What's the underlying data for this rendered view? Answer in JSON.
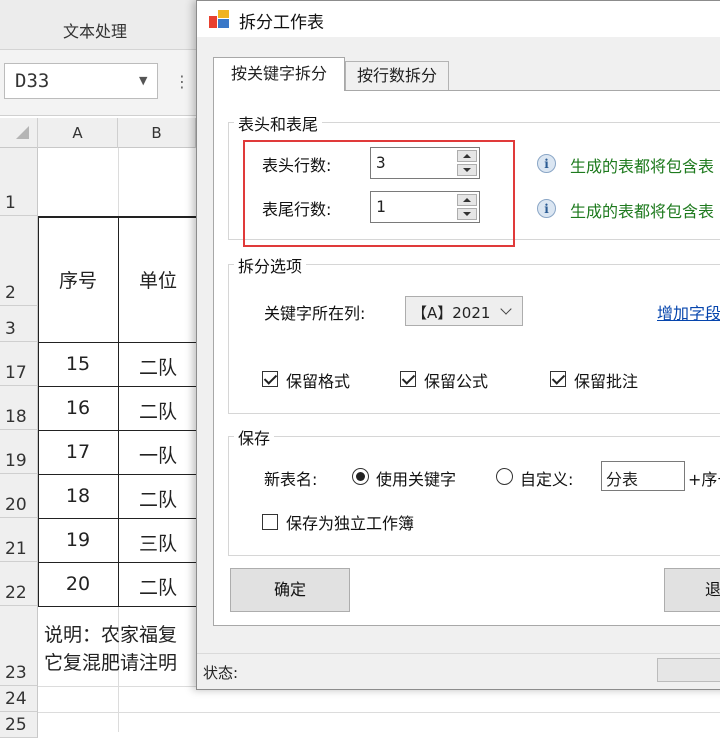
{
  "spreadsheet": {
    "ribbon_tab": "文本处理",
    "name_box": "D33",
    "columns": [
      "A",
      "B"
    ],
    "rows": [
      {
        "row": "1"
      },
      {
        "row": "2",
        "cells": [
          "序号",
          "单位"
        ]
      },
      {
        "row": "3"
      },
      {
        "row": "17",
        "cells": [
          "15",
          "二队"
        ]
      },
      {
        "row": "18",
        "cells": [
          "16",
          "二队"
        ]
      },
      {
        "row": "19",
        "cells": [
          "17",
          "一队"
        ]
      },
      {
        "row": "20",
        "cells": [
          "18",
          "二队"
        ]
      },
      {
        "row": "21",
        "cells": [
          "19",
          "三队"
        ]
      },
      {
        "row": "22",
        "cells": [
          "20",
          "二队"
        ]
      },
      {
        "row": "23"
      },
      {
        "row": "24"
      },
      {
        "row": "25"
      }
    ],
    "note_line1": "说明：农家福复",
    "note_line2": "它复混肥请注明"
  },
  "dialog": {
    "title": "拆分工作表",
    "tabs": [
      {
        "label": "按关键字拆分",
        "active": true
      },
      {
        "label": "按行数拆分",
        "active": false
      }
    ],
    "header_footer": {
      "title": "表头和表尾",
      "header_rows_label": "表头行数:",
      "header_rows_value": "3",
      "footer_rows_label": "表尾行数:",
      "footer_rows_value": "1",
      "info_text_1": "生成的表都将包含表",
      "info_text_2": "生成的表都将包含表"
    },
    "split_options": {
      "title": "拆分选项",
      "key_column_label": "关键字所在列:",
      "key_column_value": "【A】2021",
      "add_link": "增加字段",
      "keep_format": {
        "label": "保留格式",
        "checked": true
      },
      "keep_formula": {
        "label": "保留公式",
        "checked": true
      },
      "keep_comment": {
        "label": "保留批注",
        "checked": true
      }
    },
    "save": {
      "title": "保存",
      "new_name_label": "新表名:",
      "use_keyword": {
        "label": "使用关键字",
        "selected": true
      },
      "custom": {
        "label": "自定义:",
        "selected": false
      },
      "custom_value": "分表",
      "suffix": "+序号",
      "separate_workbook": {
        "label": "保存为独立工作簿",
        "checked": false
      }
    },
    "ok_button": "确定",
    "exit_button": "退出",
    "status_label": "状态:"
  },
  "colors": {
    "highlight_border": "#e03a3a",
    "info_text": "#1e7a1e",
    "link": "#0645ad"
  },
  "icons": [
    "app-icon",
    "info-icon",
    "chevron-down-icon",
    "checkbox-icon",
    "radio-icon"
  ]
}
